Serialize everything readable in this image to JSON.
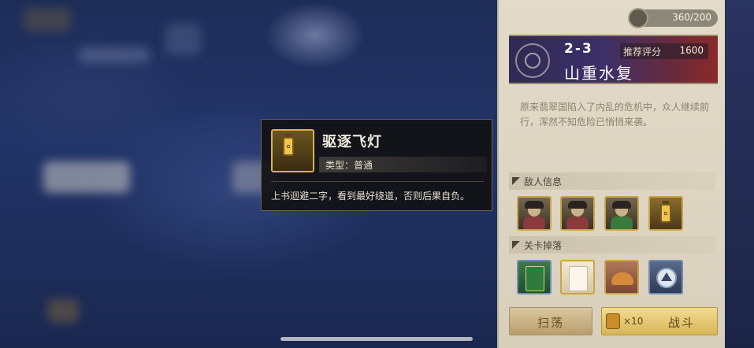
{
  "tooltip": {
    "item_name": "驱逐飞灯",
    "type_text": "类型：普通",
    "description": "上书迴避二字，看到最好绕道，否则后果自负。",
    "icon": "lantern-icon"
  },
  "resource": {
    "stamina_text": "360/200",
    "icon": "stamina-icon"
  },
  "stage": {
    "number": "2-3",
    "title": "山重水复",
    "score_label": "推荐评分",
    "score_value": "1600",
    "description": "原来翡翠国陷入了内乱的危机中，众人继续前行，浑然不知危险已悄悄来袭。"
  },
  "enemies": {
    "header": "敌人信息",
    "items": [
      {
        "icon": "enemy-soldier-icon",
        "color": "#8a3a3a"
      },
      {
        "icon": "enemy-soldier-icon",
        "color": "#8a3a3a"
      },
      {
        "icon": "enemy-soldier-icon",
        "color": "#3a7a3a"
      },
      {
        "icon": "lantern-icon",
        "color": "#f4c54e"
      }
    ]
  },
  "drops": {
    "header": "关卡掉落",
    "items": [
      {
        "icon": "green-card-icon"
      },
      {
        "icon": "paper-card-icon"
      },
      {
        "icon": "croissant-icon"
      },
      {
        "icon": "rank-badge-icon"
      }
    ]
  },
  "actions": {
    "sweep_label": "扫荡",
    "fight_cost": "×10",
    "fight_label": "战斗"
  }
}
